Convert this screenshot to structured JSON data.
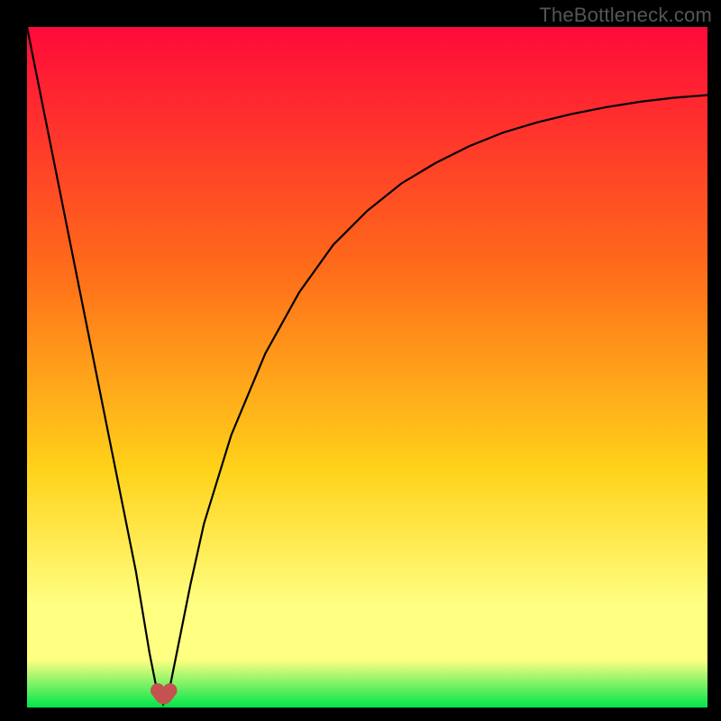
{
  "watermark": "TheBottleneck.com",
  "palette": {
    "black": "#000000",
    "gradient_top": "#ff0a3a",
    "gradient_mid1": "#ff6a1a",
    "gradient_mid2": "#ffd21a",
    "gradient_mid3": "#ffff82",
    "gradient_bottom": "#00e54a",
    "curve": "#000000",
    "marker": "#c4524f"
  },
  "chart_data": {
    "type": "line",
    "title": "",
    "xlabel": "",
    "ylabel": "",
    "xlim": [
      0,
      100
    ],
    "ylim": [
      0,
      100
    ],
    "series": [
      {
        "name": "bottleneck-curve",
        "x": [
          0,
          2,
          4,
          6,
          8,
          10,
          12,
          14,
          16,
          18,
          19,
          20,
          21,
          22,
          24,
          26,
          30,
          35,
          40,
          45,
          50,
          55,
          60,
          65,
          70,
          75,
          80,
          85,
          90,
          95,
          100
        ],
        "y": [
          100,
          90,
          80,
          70,
          60,
          50,
          40,
          30,
          20,
          8,
          3,
          0.5,
          3,
          8,
          18,
          27,
          40,
          52,
          61,
          68,
          73,
          77,
          80,
          82.5,
          84.5,
          86,
          87.2,
          88.2,
          89,
          89.6,
          90
        ]
      }
    ],
    "markers": [
      {
        "name": "optimal-left",
        "x": 19.2,
        "y": 2.5
      },
      {
        "name": "optimal-right",
        "x": 21.0,
        "y": 2.5
      }
    ],
    "optimal_x": 20,
    "green_zone_ylim": [
      0,
      6
    ],
    "annotations": []
  }
}
